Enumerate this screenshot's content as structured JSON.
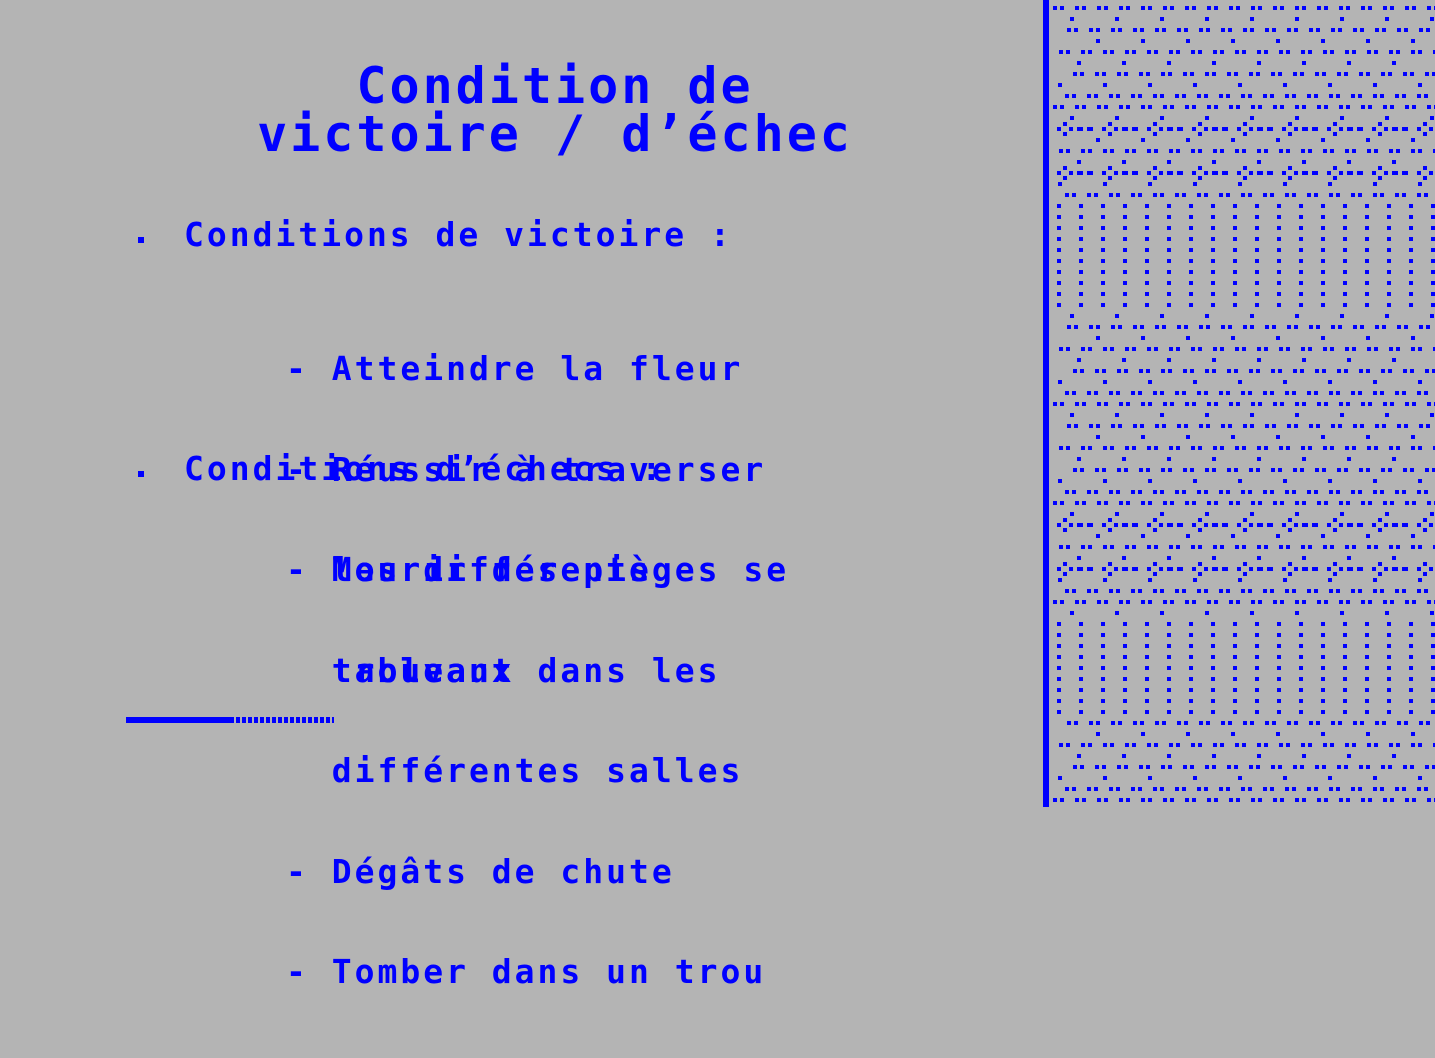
{
  "slide": {
    "title_line1": "Condition de",
    "title_line2": "victoire / d’échec",
    "section1": {
      "label": "Conditions de victoire :",
      "items": [
        "- Atteindre la fleur",
        "- Réussir à traverser",
        "  les différents",
        "  tableaux"
      ]
    },
    "section2": {
      "label": "Conditions d’échecs :",
      "items": [
        "- Mourir des pièges se",
        "  trouvant dans les",
        "  différentes salles",
        "- Dégâts de chute",
        "- Tomber dans un trou"
      ]
    },
    "progress": 0.5
  },
  "colors": {
    "background": "#b4b4b4",
    "accent": "#0000ff"
  }
}
